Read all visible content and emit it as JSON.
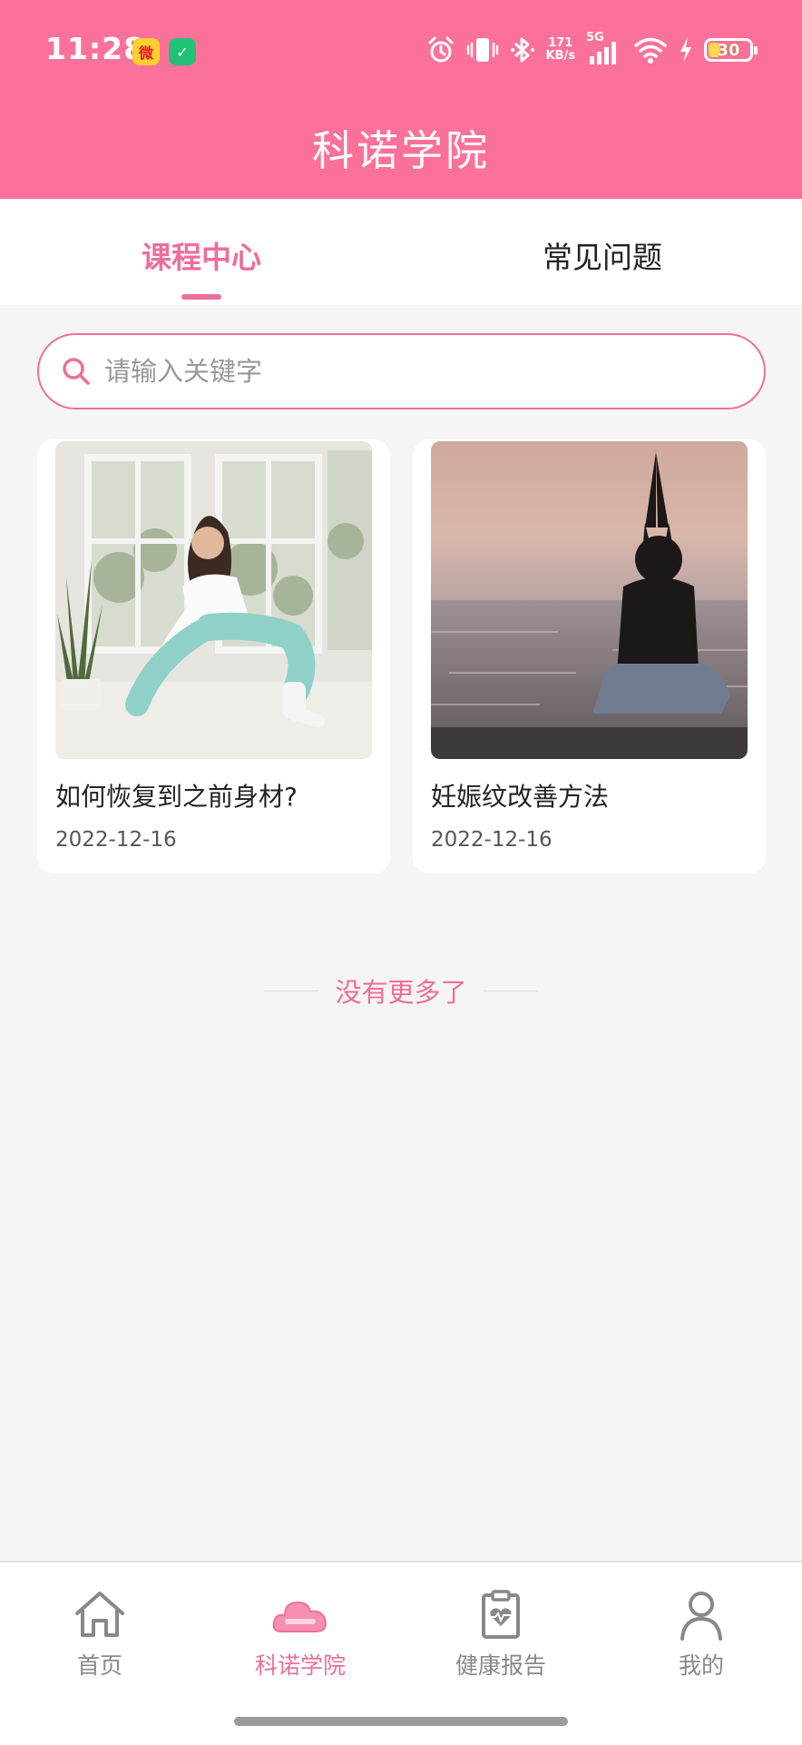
{
  "status_bar": {
    "time": "11:28",
    "apps": [
      "weibo-icon",
      "wechat-icon"
    ],
    "net_speed_value": "171",
    "net_speed_unit": "KB/s",
    "network": "5G",
    "battery": "30",
    "battery_level": 0.3
  },
  "header": {
    "title": "科诺学院"
  },
  "tabs": [
    {
      "label": "课程中心",
      "active": true
    },
    {
      "label": "常见问题",
      "active": false
    }
  ],
  "search": {
    "placeholder": "请输入关键字",
    "value": ""
  },
  "courses": [
    {
      "title": "如何恢复到之前身材?",
      "date": "2022-12-16"
    },
    {
      "title": "妊娠纹改善方法",
      "date": "2022-12-16"
    }
  ],
  "list_footer": "没有更多了",
  "bottom_nav": [
    {
      "label": "首页",
      "icon": "home-icon",
      "active": false
    },
    {
      "label": "科诺学院",
      "icon": "cloud-icon",
      "active": true
    },
    {
      "label": "健康报告",
      "icon": "clipboard-heart-icon",
      "active": false
    },
    {
      "label": "我的",
      "icon": "user-icon",
      "active": false
    }
  ],
  "colors": {
    "header": "#fc7199",
    "accent": "#ee6e9b",
    "background": "#f5f5f5"
  }
}
